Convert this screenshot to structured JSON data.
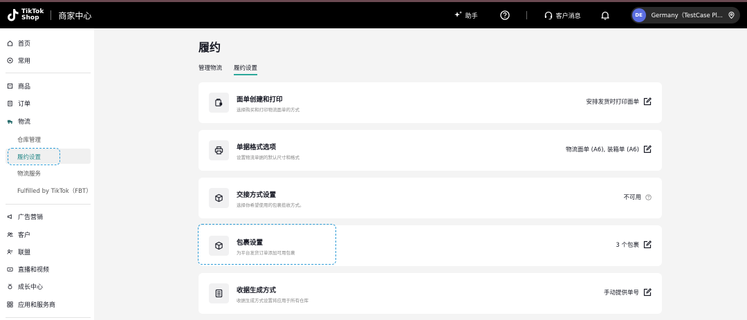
{
  "brand": {
    "line1": "TikTok",
    "line2": "Shop",
    "title": "商家中心"
  },
  "topbar": {
    "assistant": "助手",
    "customer_messages": "客户消息",
    "avatar_initials": "DE",
    "account_name": "Germany（TestCase Pl..."
  },
  "sidebar": {
    "home": "首页",
    "common": "常用",
    "products": "商品",
    "orders": "订单",
    "logistics": "物流",
    "warehouse": "仓库管理",
    "fulfillment_settings": "履约设置",
    "logistics_services": "物流服务",
    "fbt": "Fulfilled by TikTok（FBT）",
    "ads": "广告营销",
    "customers": "客户",
    "affiliate": "联盟",
    "live_video": "直播和视频",
    "growth": "成长中心",
    "apps": "应用和服务商"
  },
  "page": {
    "title": "履约",
    "tabs": [
      "管理物流",
      "履约设置"
    ]
  },
  "cards": [
    {
      "title": "面单创建和打印",
      "desc": "选择购买和打印物流面单的方式",
      "value": "安排发货时打印面单"
    },
    {
      "title": "单据格式选项",
      "desc": "设置物流单据的默认尺寸和格式",
      "value": "物流面单 (A6), 装箱单 (A6)"
    },
    {
      "title": "交接方式设置",
      "desc": "选择你希望使用的包裹揽收方式。",
      "value": "不可用"
    },
    {
      "title": "包裹设置",
      "desc": "为平台发货订单添加可用包裹",
      "value": "3 个包裹"
    },
    {
      "title": "收据生成方式",
      "desc": "收据生成方式设置将应用于所有仓库",
      "value": "手动提供单号"
    }
  ],
  "colors": {
    "accent": "#2aa89a",
    "highlight": "#2b9bd6",
    "avatar": "#5b6ee1"
  }
}
